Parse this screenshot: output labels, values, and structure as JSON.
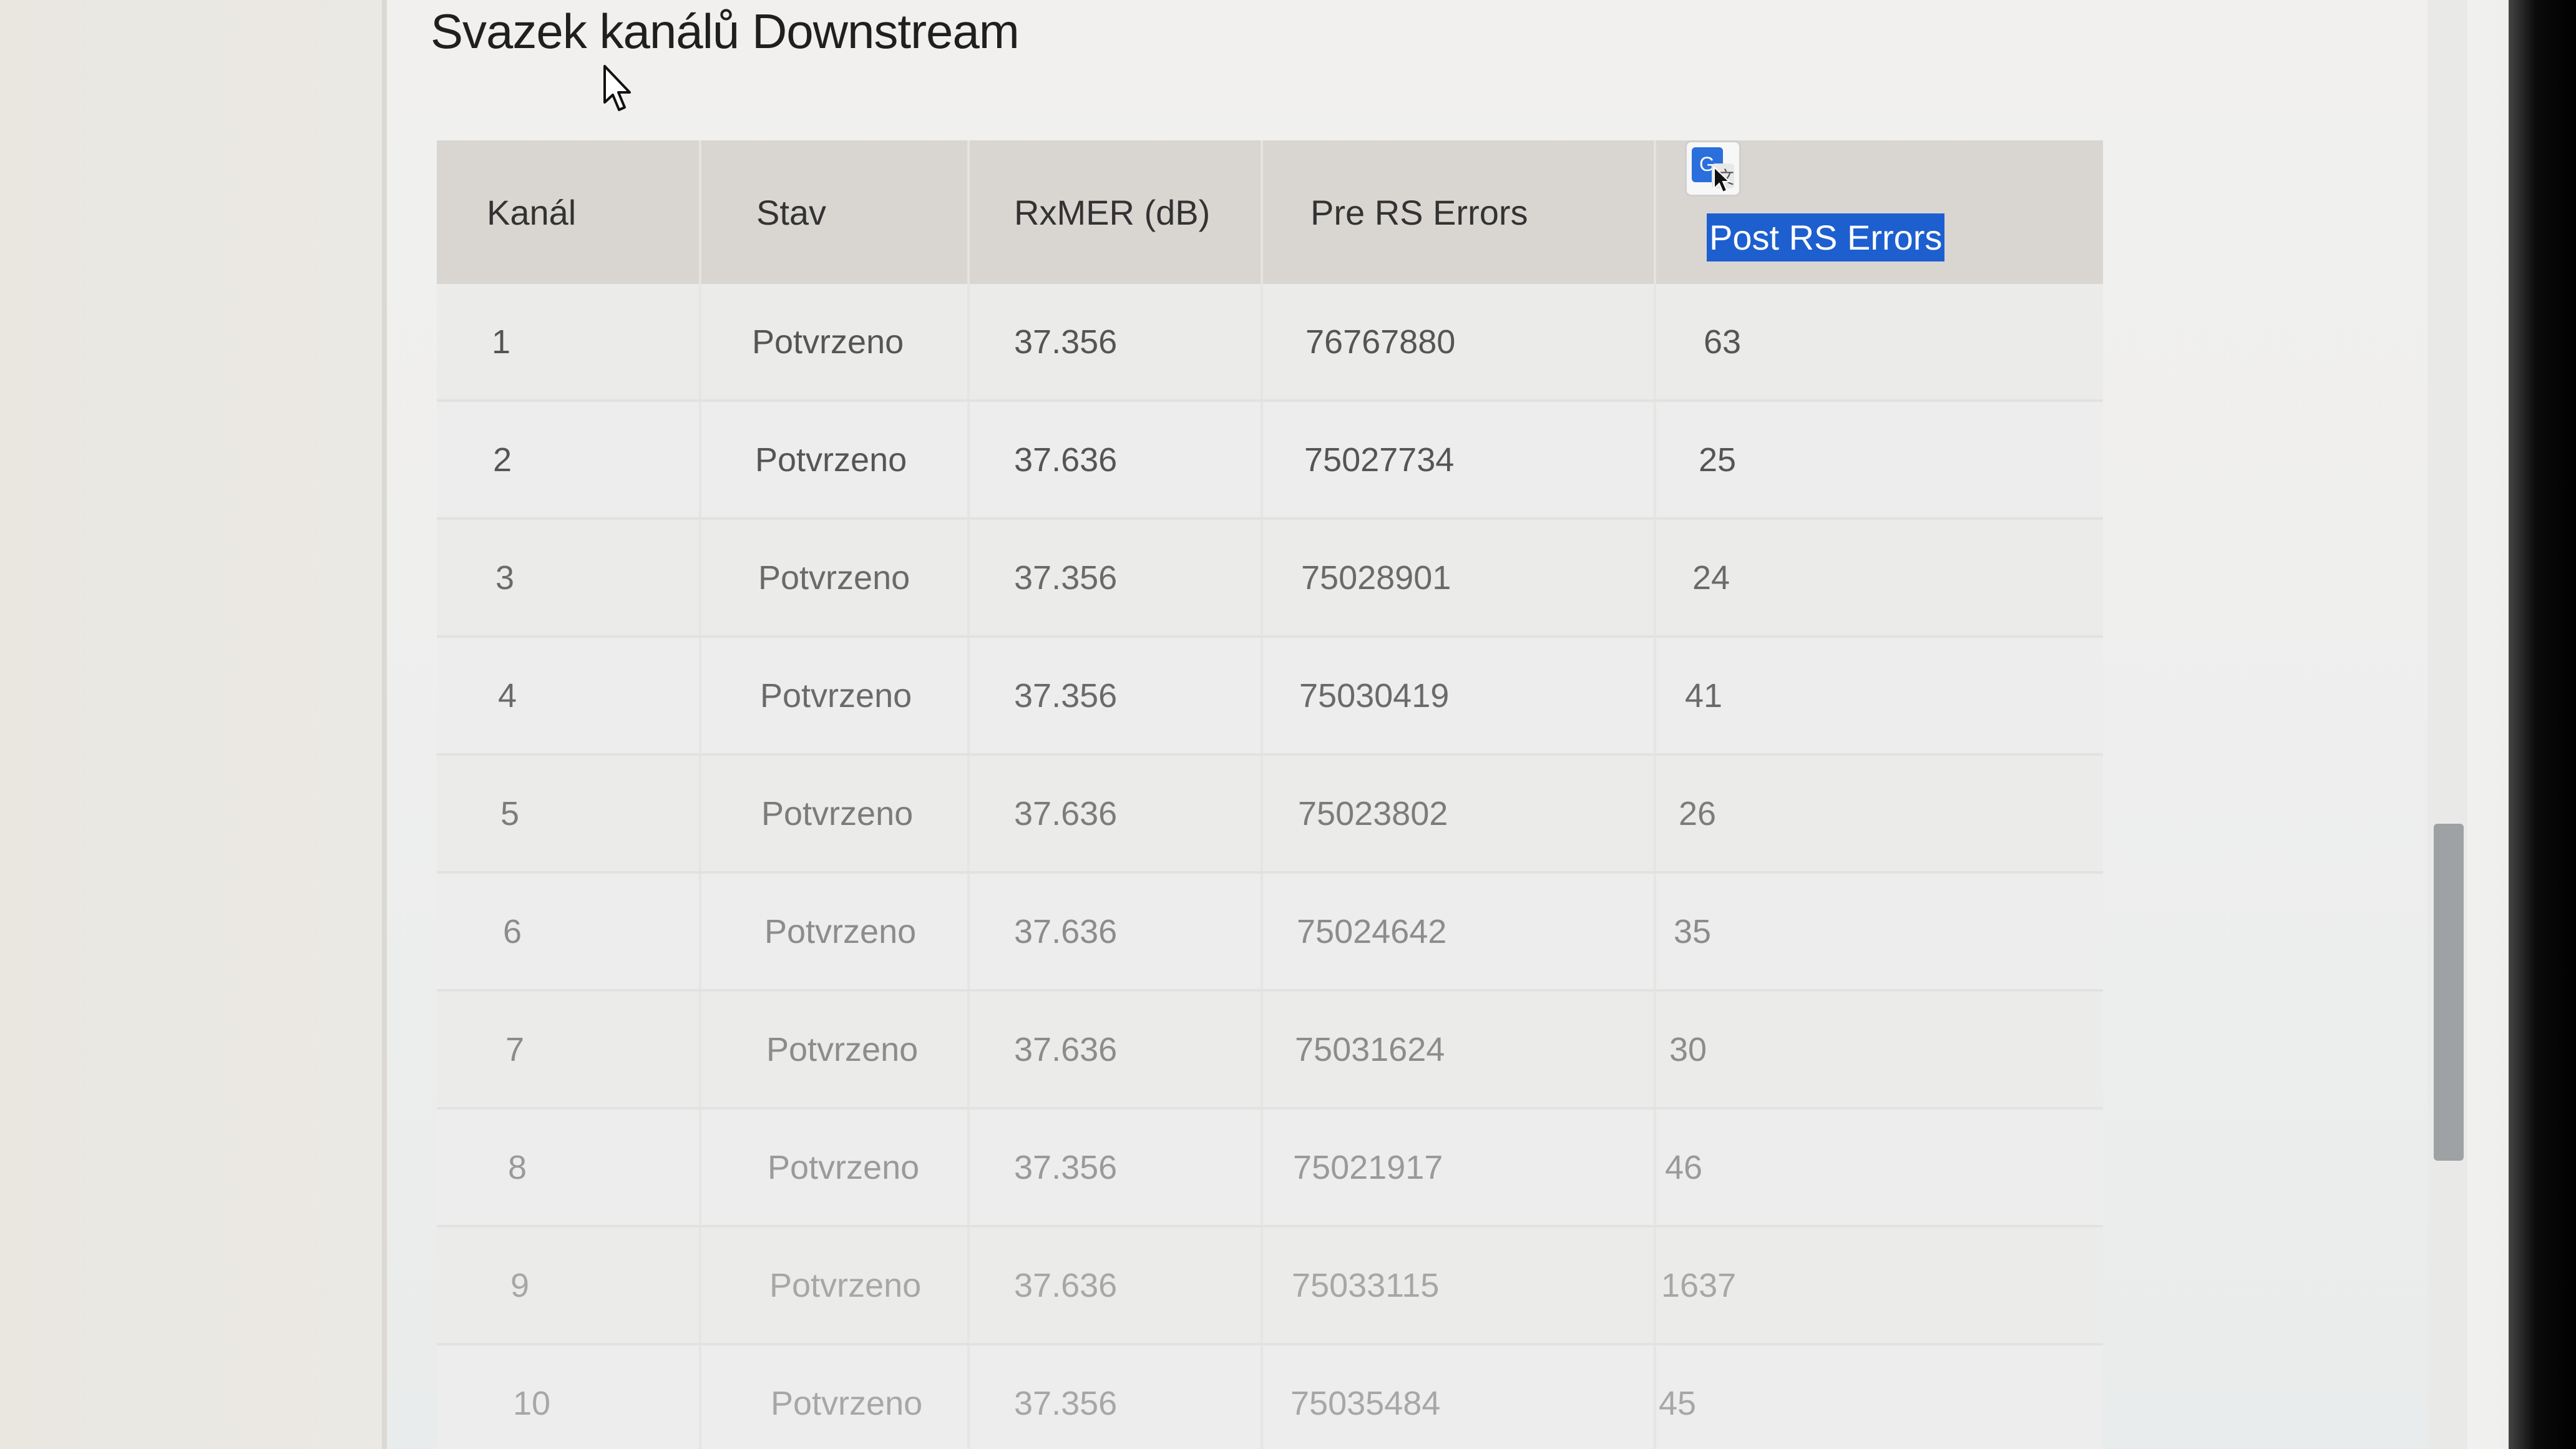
{
  "page": {
    "title": "Svazek kanálů Downstream"
  },
  "table": {
    "headers": {
      "channel": "Kanál",
      "status": "Stav",
      "rxmer": "RxMER (dB)",
      "pre_rs": "Pre RS Errors",
      "post_rs": "Post RS Errors"
    },
    "rows": [
      {
        "channel": "1",
        "status": "Potvrzeno",
        "rxmer": "37.356",
        "pre_rs": "76767880",
        "post_rs": "63"
      },
      {
        "channel": "2",
        "status": "Potvrzeno",
        "rxmer": "37.636",
        "pre_rs": "75027734",
        "post_rs": "25"
      },
      {
        "channel": "3",
        "status": "Potvrzeno",
        "rxmer": "37.356",
        "pre_rs": "75028901",
        "post_rs": "24"
      },
      {
        "channel": "4",
        "status": "Potvrzeno",
        "rxmer": "37.356",
        "pre_rs": "75030419",
        "post_rs": "41"
      },
      {
        "channel": "5",
        "status": "Potvrzeno",
        "rxmer": "37.636",
        "pre_rs": "75023802",
        "post_rs": "26"
      },
      {
        "channel": "6",
        "status": "Potvrzeno",
        "rxmer": "37.636",
        "pre_rs": "75024642",
        "post_rs": "35"
      },
      {
        "channel": "7",
        "status": "Potvrzeno",
        "rxmer": "37.636",
        "pre_rs": "75031624",
        "post_rs": "30"
      },
      {
        "channel": "8",
        "status": "Potvrzeno",
        "rxmer": "37.356",
        "pre_rs": "75021917",
        "post_rs": "46"
      },
      {
        "channel": "9",
        "status": "Potvrzeno",
        "rxmer": "37.636",
        "pre_rs": "75033115",
        "post_rs": "1637"
      },
      {
        "channel": "10",
        "status": "Potvrzeno",
        "rxmer": "37.356",
        "pre_rs": "75035484",
        "post_rs": "45"
      }
    ]
  },
  "icons": {
    "translate": "google-translate-icon",
    "cursor": "mouse-pointer-icon"
  },
  "colors": {
    "selection": "#1d5fcf",
    "header_bg": "#d9d6d2"
  }
}
